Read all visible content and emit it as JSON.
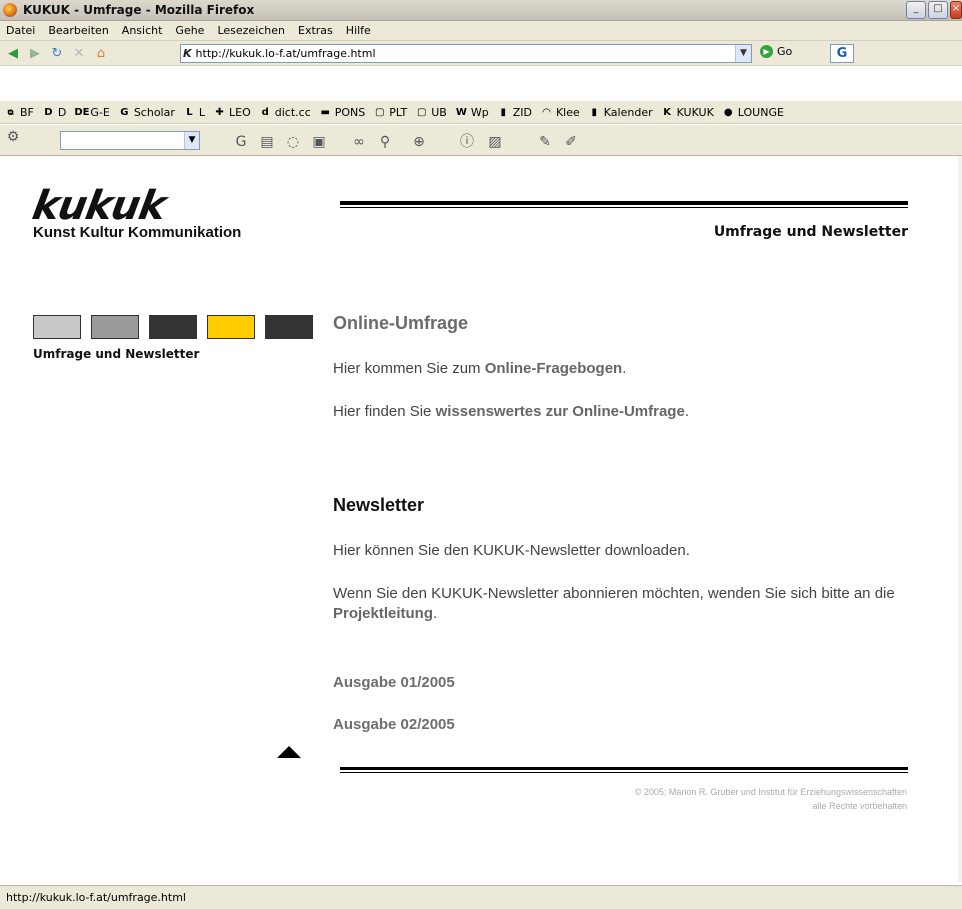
{
  "window": {
    "title": "KUKUK - Umfrage - Mozilla Firefox"
  },
  "menu": [
    "Datei",
    "Bearbeiten",
    "Ansicht",
    "Gehe",
    "Lesezeichen",
    "Extras",
    "Hilfe"
  ],
  "address": {
    "url": "http://kukuk.lo-f.at/umfrage.html",
    "go_label": "Go"
  },
  "bookmarks": [
    {
      "label": "BF",
      "icon": "bf-icon",
      "glyph": "ᴓ"
    },
    {
      "label": "D",
      "icon": "duden-icon",
      "glyph": "D"
    },
    {
      "label": "G-E",
      "icon": "dict-icon",
      "glyph": "DE"
    },
    {
      "label": "Scholar",
      "icon": "google-icon",
      "glyph": "G"
    },
    {
      "label": "L",
      "icon": "langenscheidt-icon",
      "glyph": "L"
    },
    {
      "label": "LEO",
      "icon": "leo-icon",
      "glyph": "✚"
    },
    {
      "label": "dict.cc",
      "icon": "dictcc-icon",
      "glyph": "d"
    },
    {
      "label": "PONS",
      "icon": "pons-icon",
      "glyph": "▬"
    },
    {
      "label": "PLT",
      "icon": "page-icon",
      "glyph": "▢"
    },
    {
      "label": "UB",
      "icon": "page-icon",
      "glyph": "▢"
    },
    {
      "label": "Wp",
      "icon": "wikipedia-icon",
      "glyph": "W"
    },
    {
      "label": "ZID",
      "icon": "zid-icon",
      "glyph": "▮"
    },
    {
      "label": "Klee",
      "icon": "klee-icon",
      "glyph": "◠"
    },
    {
      "label": "Kalender",
      "icon": "calendar-icon",
      "glyph": "▮"
    },
    {
      "label": "KUKUK",
      "icon": "kukuk-icon",
      "glyph": "K"
    },
    {
      "label": "LOUNGE",
      "icon": "lounge-icon",
      "glyph": "●"
    }
  ],
  "page": {
    "logo": "kukuk",
    "logo_subtitle": "Kunst Kultur Kommunikation",
    "section_title": "Umfrage und Newsletter",
    "side_label": "Umfrage und Newsletter",
    "swatch_colors": [
      "#c8c8c8",
      "#9a9a9a",
      "#333333",
      "#ffcc00",
      "#333333"
    ],
    "online_heading": "Online-Umfrage",
    "online_p1_pre": "Hier kommen Sie zum ",
    "online_p1_link": "Online-Fragebogen",
    "online_p1_post": ".",
    "online_p2_pre": "Hier finden Sie ",
    "online_p2_link": "wissenswertes zur Online-Umfrage",
    "online_p2_post": ".",
    "news_heading": "Newsletter",
    "news_p1": "Hier können Sie den KUKUK-Newsletter downloaden.",
    "news_p2_pre": "Wenn Sie den KUKUK-Newsletter abonnieren möchten, wenden Sie sich bitte an die ",
    "news_p2_link": "Projektleitung",
    "news_p2_post": ".",
    "issue1": "Ausgabe 01/2005",
    "issue2": "Ausgabe 02/2005",
    "copyright1": "© 2005; Marion R. Gruber und Institut für Erziehungswissenschaften",
    "copyright2": "alle Rechte vorbehalten"
  },
  "status": {
    "text": "http://kukuk.lo-f.at/umfrage.html"
  }
}
